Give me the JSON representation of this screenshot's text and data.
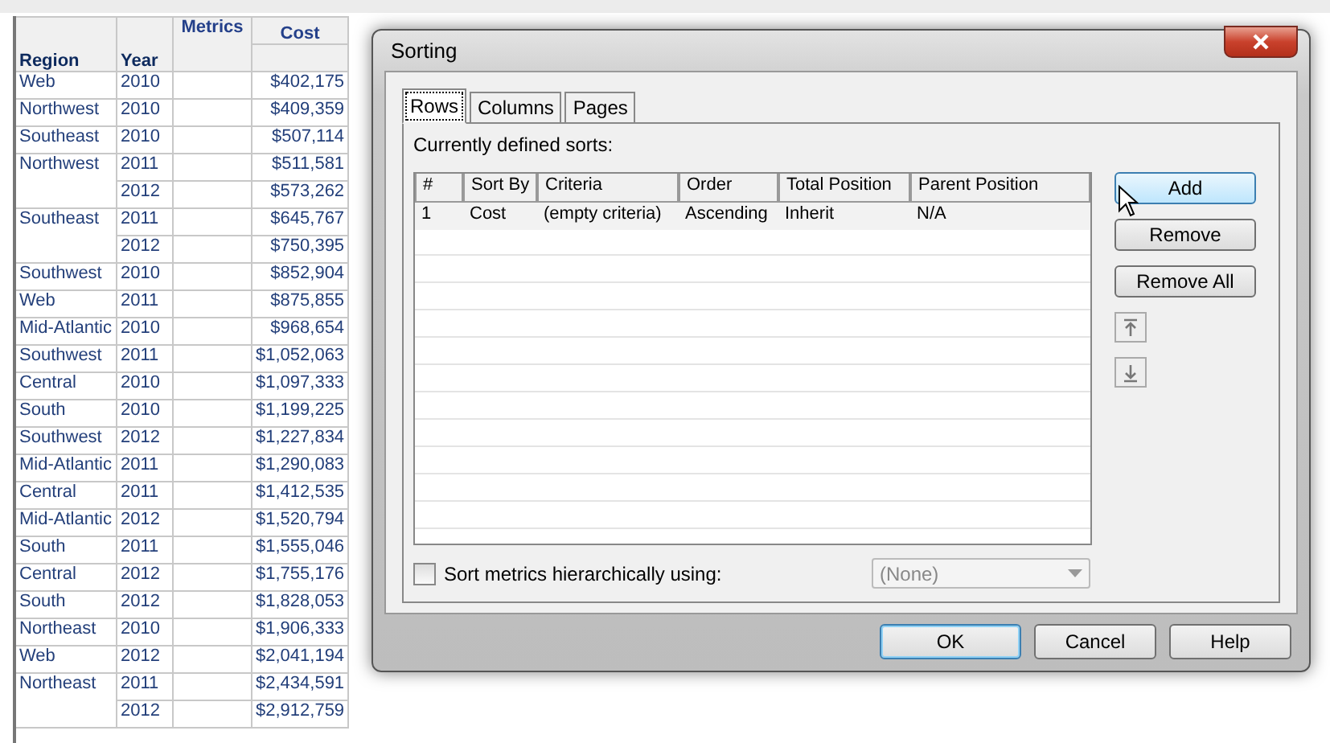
{
  "report": {
    "headers": {
      "region": "Region",
      "year": "Year",
      "metrics": "Metrics",
      "cost": "Cost"
    },
    "groups": [
      {
        "region": "Web",
        "entries": [
          {
            "year": "2010",
            "cost": "$402,175"
          }
        ]
      },
      {
        "region": "Northwest",
        "entries": [
          {
            "year": "2010",
            "cost": "$409,359"
          }
        ]
      },
      {
        "region": "Southeast",
        "entries": [
          {
            "year": "2010",
            "cost": "$507,114"
          }
        ]
      },
      {
        "region": "Northwest",
        "entries": [
          {
            "year": "2011",
            "cost": "$511,581"
          },
          {
            "year": "2012",
            "cost": "$573,262"
          }
        ]
      },
      {
        "region": "Southeast",
        "entries": [
          {
            "year": "2011",
            "cost": "$645,767"
          },
          {
            "year": "2012",
            "cost": "$750,395"
          }
        ]
      },
      {
        "region": "Southwest",
        "entries": [
          {
            "year": "2010",
            "cost": "$852,904"
          }
        ]
      },
      {
        "region": "Web",
        "entries": [
          {
            "year": "2011",
            "cost": "$875,855"
          }
        ]
      },
      {
        "region": "Mid-Atlantic",
        "entries": [
          {
            "year": "2010",
            "cost": "$968,654"
          }
        ]
      },
      {
        "region": "Southwest",
        "entries": [
          {
            "year": "2011",
            "cost": "$1,052,063"
          }
        ]
      },
      {
        "region": "Central",
        "entries": [
          {
            "year": "2010",
            "cost": "$1,097,333"
          }
        ]
      },
      {
        "region": "South",
        "entries": [
          {
            "year": "2010",
            "cost": "$1,199,225"
          }
        ]
      },
      {
        "region": "Southwest",
        "entries": [
          {
            "year": "2012",
            "cost": "$1,227,834"
          }
        ]
      },
      {
        "region": "Mid-Atlantic",
        "entries": [
          {
            "year": "2011",
            "cost": "$1,290,083"
          }
        ]
      },
      {
        "region": "Central",
        "entries": [
          {
            "year": "2011",
            "cost": "$1,412,535"
          }
        ]
      },
      {
        "region": "Mid-Atlantic",
        "entries": [
          {
            "year": "2012",
            "cost": "$1,520,794"
          }
        ]
      },
      {
        "region": "South",
        "entries": [
          {
            "year": "2011",
            "cost": "$1,555,046"
          }
        ]
      },
      {
        "region": "Central",
        "entries": [
          {
            "year": "2012",
            "cost": "$1,755,176"
          }
        ]
      },
      {
        "region": "South",
        "entries": [
          {
            "year": "2012",
            "cost": "$1,828,053"
          }
        ]
      },
      {
        "region": "Northeast",
        "entries": [
          {
            "year": "2010",
            "cost": "$1,906,333"
          }
        ]
      },
      {
        "region": "Web",
        "entries": [
          {
            "year": "2012",
            "cost": "$2,041,194"
          }
        ]
      },
      {
        "region": "Northeast",
        "entries": [
          {
            "year": "2011",
            "cost": "$2,434,591"
          },
          {
            "year": "2012",
            "cost": "$2,912,759"
          }
        ]
      }
    ]
  },
  "dialog": {
    "title": "Sorting",
    "tabs": [
      {
        "label": "Rows",
        "selected": true
      },
      {
        "label": "Columns",
        "selected": false
      },
      {
        "label": "Pages",
        "selected": false
      }
    ],
    "sorts_label": "Currently defined sorts:",
    "sorts_table": {
      "columns": [
        "#",
        "Sort By",
        "Criteria",
        "Order",
        "Total Position",
        "Parent Position"
      ],
      "rows": [
        [
          "1",
          "Cost",
          "(empty criteria)",
          "Ascending",
          "Inherit",
          "N/A"
        ]
      ]
    },
    "side_buttons": [
      {
        "label": "Add",
        "focused": true
      },
      {
        "label": "Remove",
        "focused": false
      },
      {
        "label": "Remove All",
        "focused": false
      }
    ],
    "hierarchical": {
      "label": "Sort metrics hierarchically using:",
      "checked": false,
      "value": "(None)"
    },
    "buttons": [
      {
        "label": "OK",
        "default": true
      },
      {
        "label": "Cancel",
        "default": false
      },
      {
        "label": "Help",
        "default": false
      }
    ]
  }
}
